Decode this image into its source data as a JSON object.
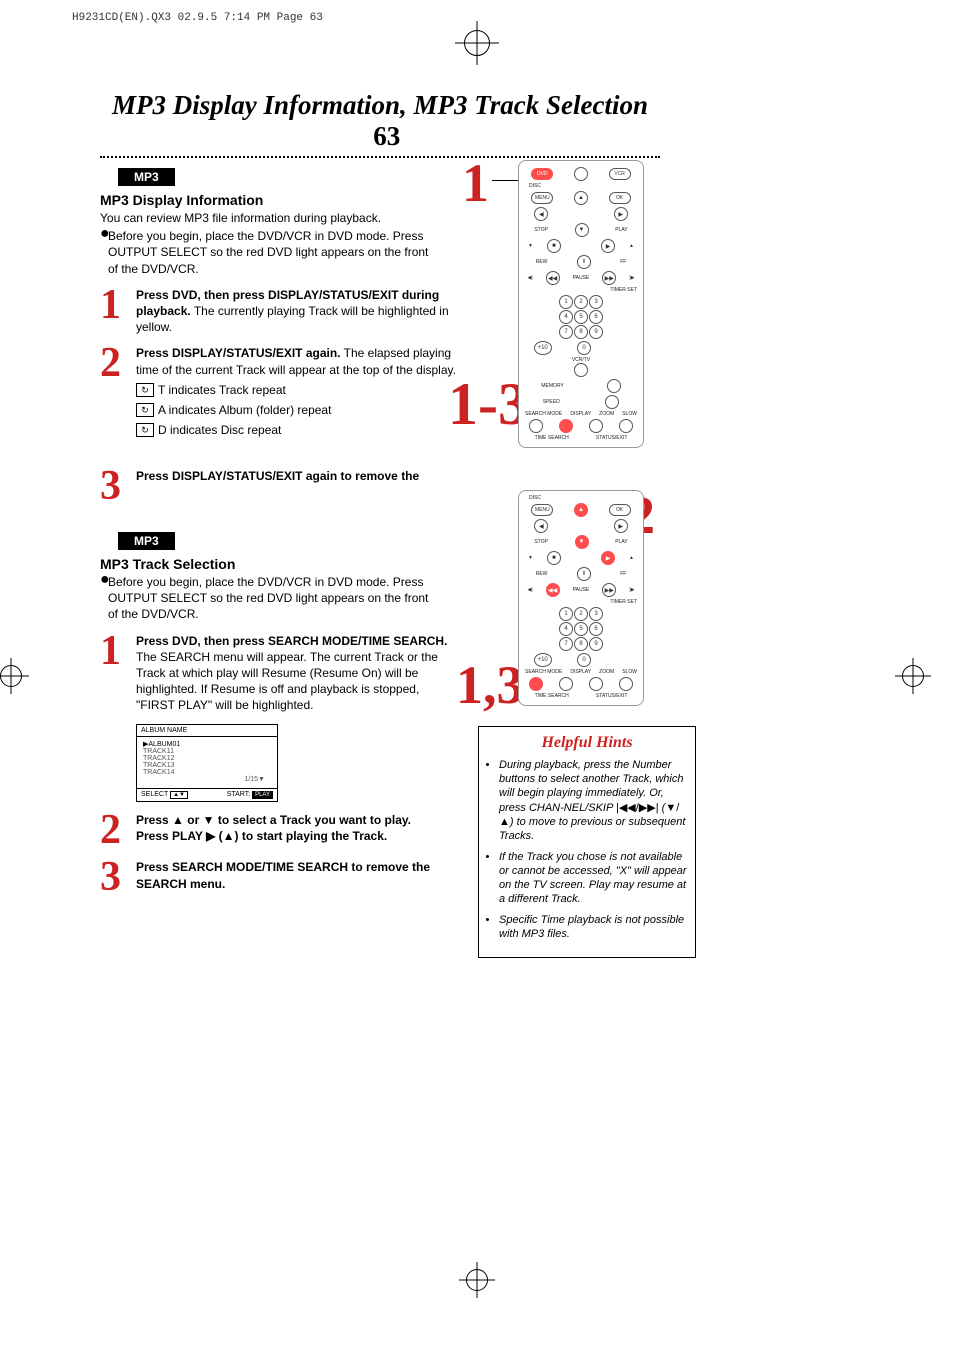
{
  "meta": {
    "docline": "H9231CD(EN).QX3  02.9.5 7:14 PM  Page 63"
  },
  "title": {
    "text": "MP3 Display Information, MP3 Track Selection",
    "pagenum": "63"
  },
  "tag_mp3": "MP3",
  "section1": {
    "heading": "MP3 Display Information",
    "intro": "You can review MP3 file information during playback.",
    "bullet1": "Before you begin, place the DVD/VCR in DVD mode. Press OUTPUT SELECT so the red DVD light appears on the front of the DVD/VCR.",
    "step1_bold": "Press DVD, then press DISPLAY/STATUS/EXIT during playback.",
    "step1_rest": " The currently playing Track will be highlighted in yellow.",
    "step2_bold": "Press DISPLAY/STATUS/EXIT again.",
    "step2_rest": " The elapsed playing time of the current Track will appear at the top of the display.",
    "repeat_t": "T indicates Track repeat",
    "repeat_a": "A indicates Album (folder) repeat",
    "repeat_d": "D indicates Disc repeat",
    "step3_bold": "Press DISPLAY/STATUS/EXIT again to remove the"
  },
  "callouts": {
    "c1": "1",
    "c13": "1-3",
    "c2": "2",
    "c13b": "1,3"
  },
  "section2": {
    "heading": "MP3 Track Selection",
    "bullet1": "Before you begin, place the DVD/VCR in DVD mode. Press OUTPUT SELECT so the red DVD light appears on the front of the DVD/VCR.",
    "step1_bold": "Press DVD, then press SEARCH MODE/TIME SEARCH.",
    "step1_rest": " The SEARCH menu will appear. The current Track or the Track at which play will Resume (Resume On) will be highlighted. If Resume is off and playback is stopped, \"FIRST PLAY\" will be highlighted.",
    "step2_line1a": "Press ",
    "step2_tri_up": "▲",
    "step2_line1b": " or ",
    "step2_tri_dn": "▼",
    "step2_line1c": "  to select a Track you want to play.",
    "step2_line2a": "Press PLAY ",
    "step2_play": "▶",
    "step2_line2b": " (",
    "step2_up2": "▲",
    "step2_line2c": ") to start playing the Track.",
    "step3_bold": "Press SEARCH MODE/TIME SEARCH to remove the SEARCH menu."
  },
  "screen": {
    "header": "ALBUM NAME",
    "album": "▶ALBUM01",
    "t1": "TRACK11",
    "t2": "TRACK12",
    "t3": "TRACK13",
    "t4": "TRACK14",
    "pages": "1/15▼",
    "ftr_select": "SELECT",
    "ftr_start": "START:",
    "ftr_play": "PLAY"
  },
  "hints": {
    "title": "Helpful Hints",
    "h1": "During playback, press the Number buttons to select another Track, which will begin playing immediately. Or, press CHAN-NEL/SKIP ",
    "h1_sym": "|◀◀/▶▶|",
    "h1b": " (",
    "h1_dn": "▼",
    "h1_slash": "/",
    "h1_up": "▲",
    "h1c": ") to move to previous or subsequent Tracks.",
    "h2": "If the Track you chose is not available or cannot be accessed, \"X\" will appear on the TV screen. Play may resume at a different Track.",
    "h3": "Specific Time playback is not possible with MP3 files."
  },
  "remote": {
    "dvd": "DVD",
    "vcr": "VCR",
    "disc": "DISC",
    "menu": "MENU",
    "ok": "OK",
    "stop": "STOP",
    "play": "PLAY",
    "rew": "REW",
    "ff": "FF",
    "pause": "PAUSE",
    "timer": "TIMER SET",
    "vcrtv": "VCR/TV",
    "memory": "MEMORY",
    "speed": "SPEED",
    "search": "SEARCH MODE",
    "display": "DISPLAY",
    "zoom": "ZOOM",
    "slow": "SLOW",
    "timesearch": "TIME SEARCH",
    "status": "STATUS/EXIT",
    "tri_up": "▲",
    "tri_dn": "▼",
    "tri_l": "◀",
    "tri_r": "▶",
    "sq": "■",
    "pl": "▶",
    "rw": "◀◀",
    "fw": "▶▶",
    "pa": "‖",
    "p10": "+10",
    "n0": "0",
    "n1": "1",
    "n2": "2",
    "n3": "3",
    "n4": "4",
    "n5": "5",
    "n6": "6",
    "n7": "7",
    "n8": "8",
    "n9": "9"
  }
}
